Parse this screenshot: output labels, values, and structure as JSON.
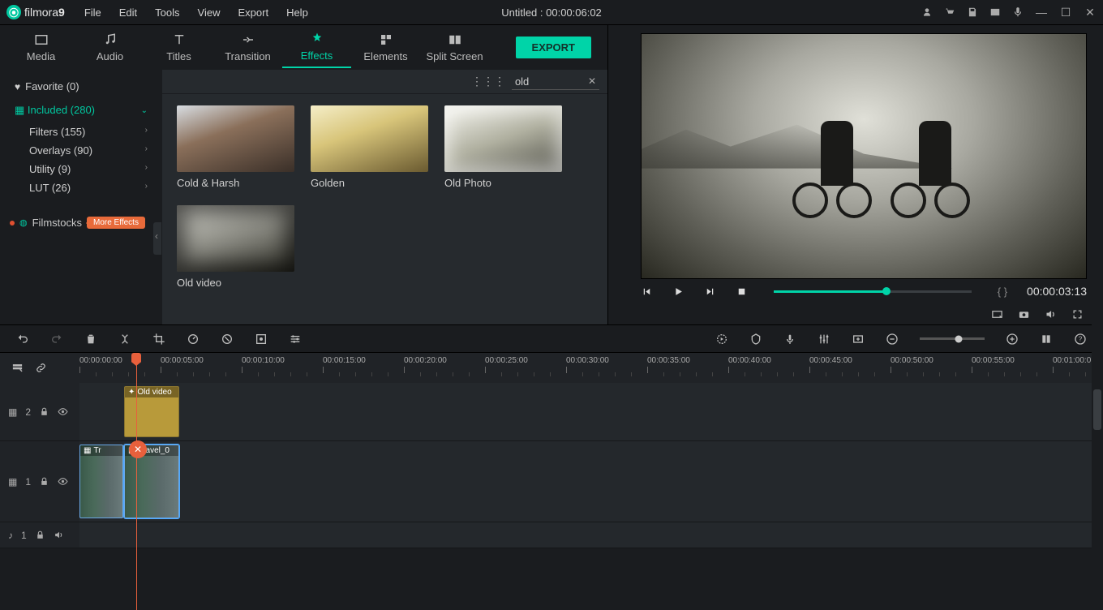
{
  "app": {
    "name": "filmora",
    "version": "9",
    "title": "Untitled : 00:00:06:02"
  },
  "menu": [
    "File",
    "Edit",
    "Tools",
    "View",
    "Export",
    "Help"
  ],
  "tabs": [
    "Media",
    "Audio",
    "Titles",
    "Transition",
    "Effects",
    "Elements",
    "Split Screen"
  ],
  "tabs_active_index": 4,
  "export_label": "EXPORT",
  "sidebar": {
    "favorite": "Favorite (0)",
    "included": "Included (280)",
    "subs": [
      {
        "label": "Filters (155)"
      },
      {
        "label": "Overlays (90)"
      },
      {
        "label": "Utility (9)"
      },
      {
        "label": "LUT (26)"
      }
    ],
    "filmstocks": "Filmstocks",
    "more_effects": "More Effects"
  },
  "search": {
    "value": "old"
  },
  "effects": [
    {
      "label": "Cold & Harsh"
    },
    {
      "label": "Golden"
    },
    {
      "label": "Old Photo"
    },
    {
      "label": "Old video"
    }
  ],
  "preview": {
    "timecode": "00:00:03:13",
    "markers": "{   }"
  },
  "ruler": [
    "00:00:00:00",
    "00:00:05:00",
    "00:00:10:00",
    "00:00:15:00",
    "00:00:20:00",
    "00:00:25:00",
    "00:00:30:00",
    "00:00:35:00",
    "00:00:40:00",
    "00:00:45:00",
    "00:00:50:00",
    "00:00:55:00",
    "00:01:00:0"
  ],
  "tracks": {
    "fx": {
      "icon": "▦",
      "num": "2",
      "clip_label": "Old video"
    },
    "vid": {
      "icon": "▦",
      "num": "1",
      "clip1": "Tr",
      "clip2": "Travel_0"
    },
    "aud": {
      "icon": "♪",
      "num": "1"
    }
  }
}
